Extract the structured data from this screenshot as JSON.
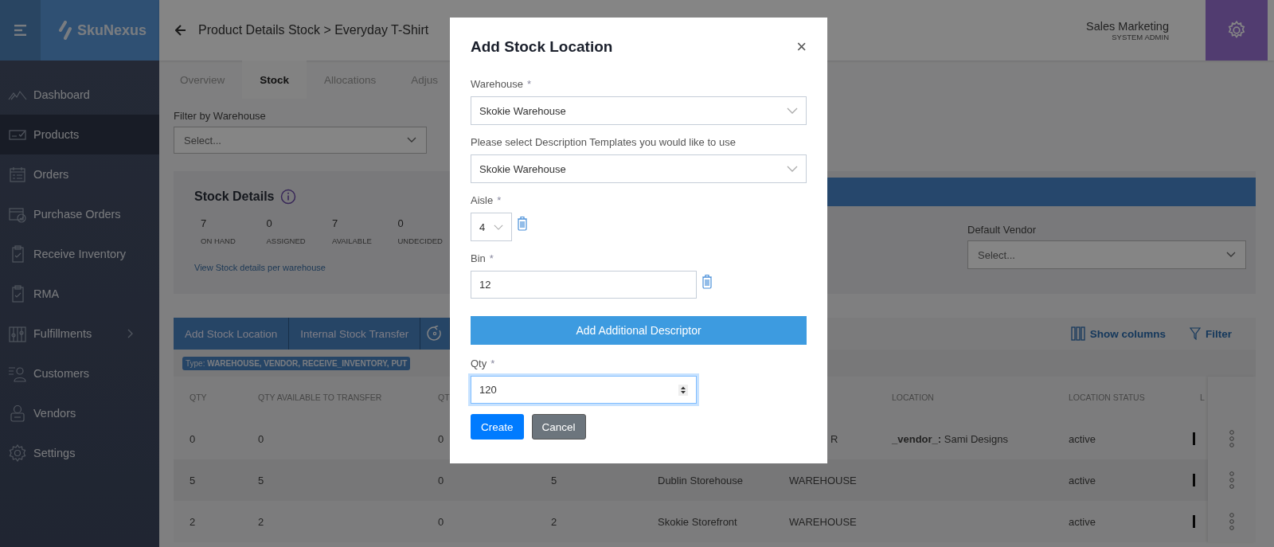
{
  "app": {
    "logo": "SkuNexus",
    "user": {
      "name": "Sales Marketing",
      "role": "SYSTEM ADMIN"
    }
  },
  "sidebar": {
    "items": [
      {
        "label": "Dashboard",
        "selected": false
      },
      {
        "label": "Products",
        "selected": true
      },
      {
        "label": "Orders",
        "selected": false
      },
      {
        "label": "Purchase Orders",
        "selected": false
      },
      {
        "label": "Receive Inventory",
        "selected": false
      },
      {
        "label": "RMA",
        "selected": false
      },
      {
        "label": "Fulfillments",
        "selected": false,
        "has_children": true
      },
      {
        "label": "Customers",
        "selected": false
      },
      {
        "label": "Vendors",
        "selected": false
      },
      {
        "label": "Settings",
        "selected": false
      }
    ]
  },
  "page": {
    "title": "Product Details Stock > Everyday T-Shirt",
    "tabs": [
      {
        "label": "Overview",
        "selected": false
      },
      {
        "label": "Stock",
        "selected": true
      },
      {
        "label": "Allocations",
        "selected": false
      },
      {
        "label": "Adjus",
        "selected": false
      }
    ],
    "filter": {
      "label": "Filter by Warehouse",
      "placeholder": "Select..."
    },
    "stock_details": {
      "title": "Stock Details",
      "stats": [
        {
          "value": "7",
          "label": "ON HAND"
        },
        {
          "value": "0",
          "label": "ASSIGNED"
        },
        {
          "value": "7",
          "label": "AVAILABLE"
        },
        {
          "value": "0",
          "label": "UNDECIDED"
        }
      ],
      "link": "View Stock details per warehouse",
      "vendor_label": "Default Vendor",
      "vendor_placeholder": "Select..."
    },
    "toolbar": {
      "buttons": [
        "Add Stock Location",
        "Internal Stock Transfer"
      ],
      "show_columns": "Show columns",
      "filter": "Filter"
    },
    "type_tag": "Type: **WAREHOUSE, VENDOR, RECEIVE_INVENTORY, PUT**",
    "table": {
      "columns": [
        "QTY",
        "QTY AVAILABLE TO TRANSFER",
        "QT",
        "",
        "",
        "",
        "LOCATION",
        "LOCATION STATUS",
        "L"
      ],
      "rows": [
        {
          "cells": [
            "0",
            "0",
            "0",
            "",
            "",
            "R",
            "**_vendor_:**  Sami Designs",
            "active"
          ]
        },
        {
          "cells": [
            "5",
            "5",
            "0",
            "5",
            "Dublin Storehouse",
            "WAREHOUSE",
            "",
            "active"
          ]
        },
        {
          "cells": [
            "2",
            "2",
            "0",
            "2",
            "Skokie Storefront",
            "WAREHOUSE",
            "",
            "active"
          ]
        }
      ]
    }
  },
  "modal": {
    "title": "Add Stock Location",
    "close": "×",
    "warehouse": {
      "label": "Warehouse",
      "required": "*",
      "value": "Skokie Warehouse"
    },
    "template": {
      "label": "Please select Description Templates you would like to use",
      "value": "Skokie Warehouse"
    },
    "aisle": {
      "label": "Aisle",
      "required": "*",
      "value": "4"
    },
    "bin": {
      "label": "Bin",
      "required": "*",
      "value": "12"
    },
    "add_descriptor": "Add Additional Descriptor",
    "qty": {
      "label": "Qty",
      "required": "*",
      "value": "120"
    },
    "buttons": [
      {
        "label": "Create",
        "kind": "primary"
      },
      {
        "label": "Cancel",
        "kind": "secondary"
      }
    ]
  }
}
